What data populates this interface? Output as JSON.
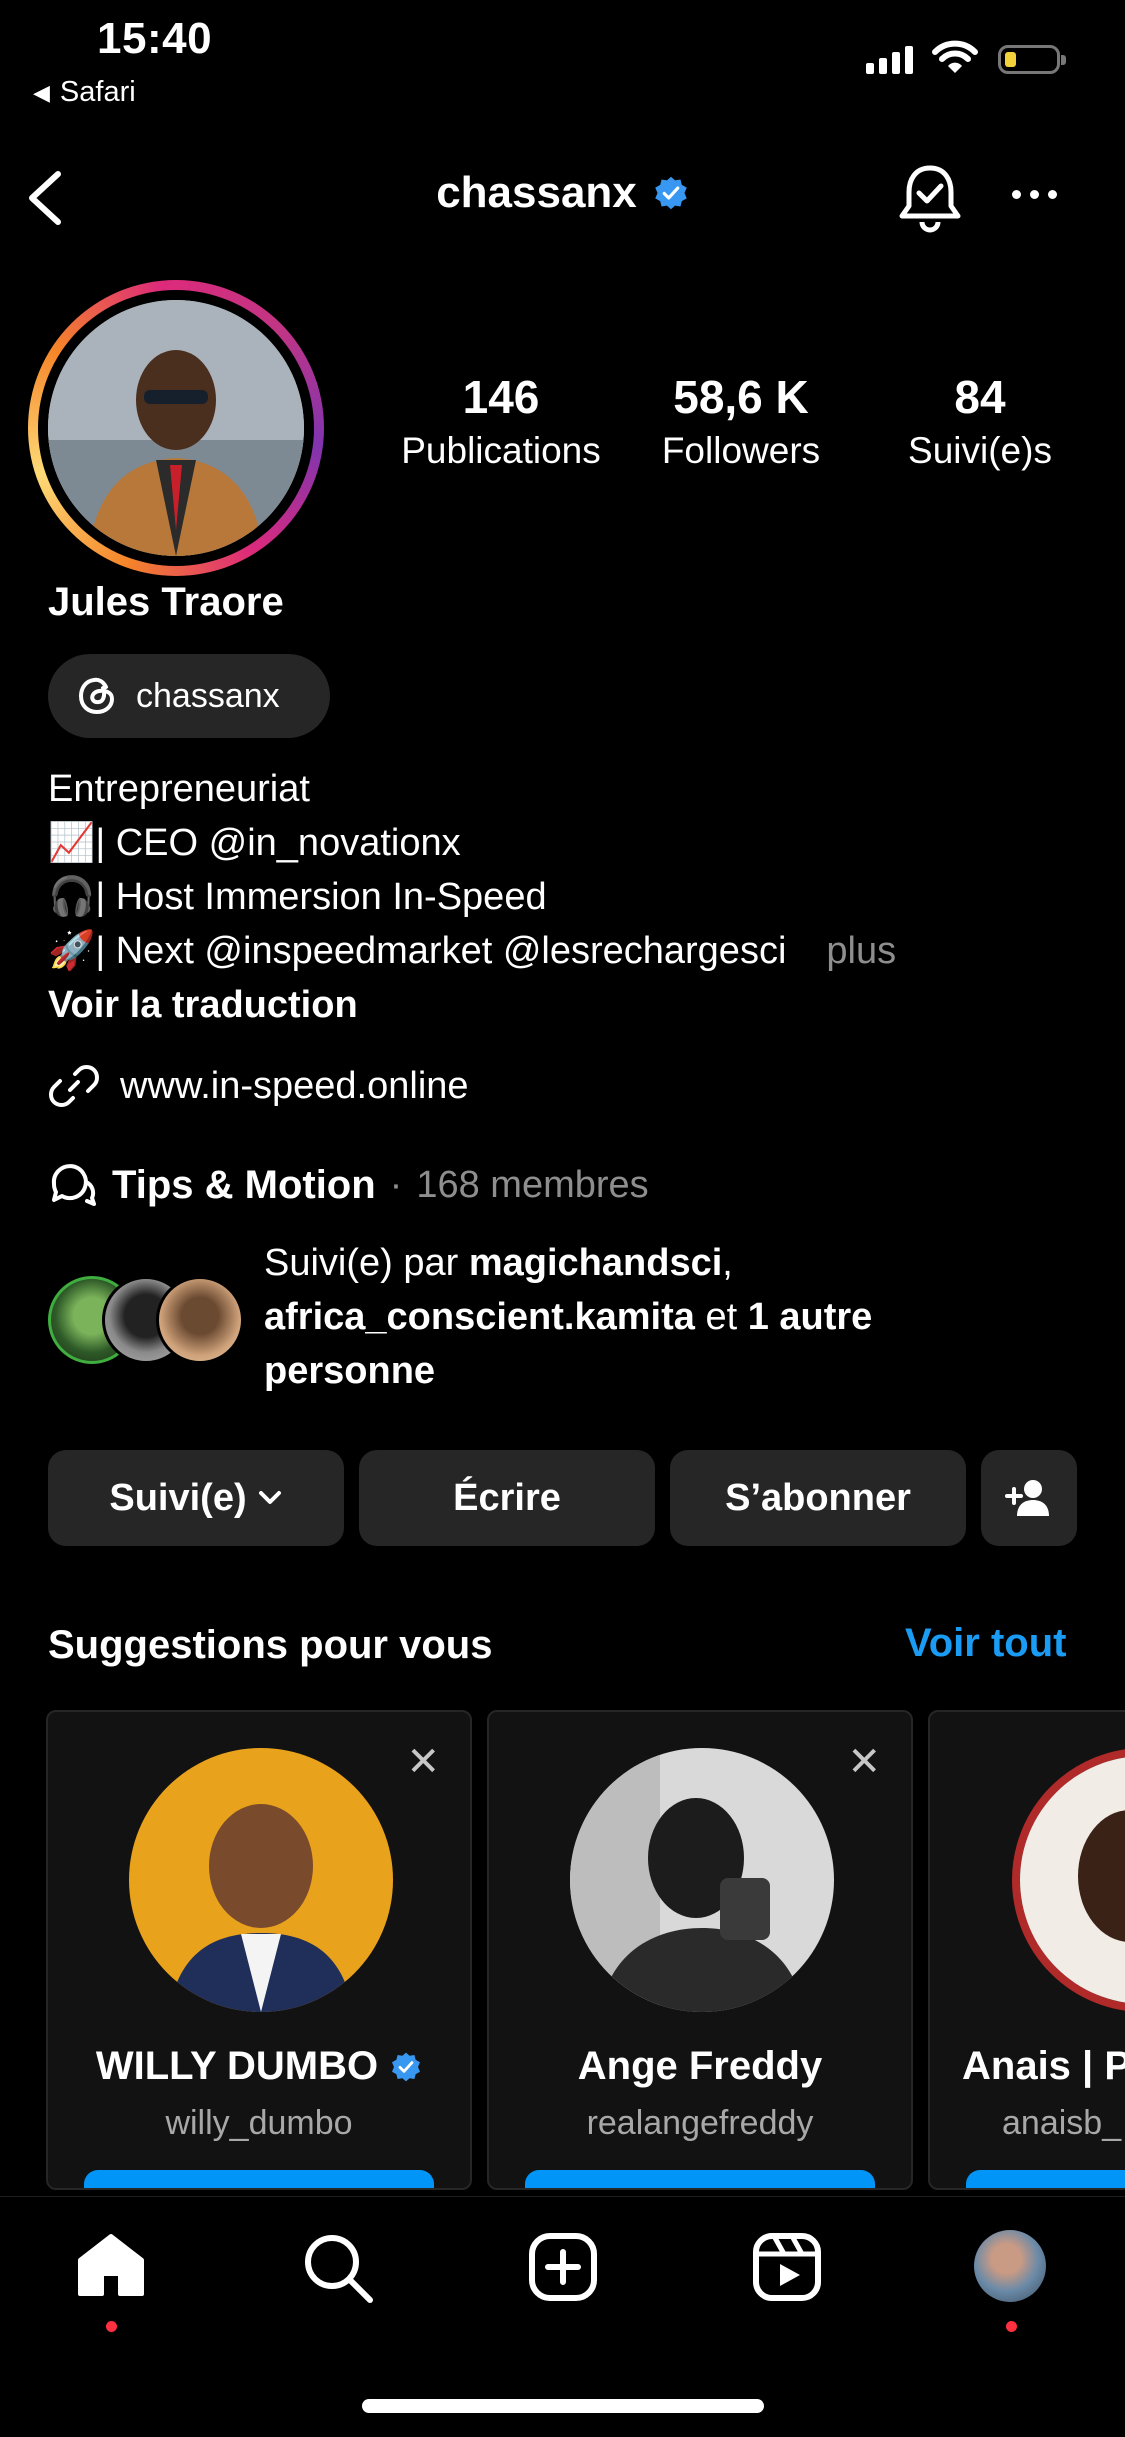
{
  "status_bar": {
    "time": "15:40",
    "back_app": "Safari"
  },
  "header": {
    "username": "chassanx"
  },
  "profile": {
    "full_name": "Jules Traore",
    "threads_handle": "chassanx",
    "stats": [
      {
        "value": "146",
        "label": "Publications"
      },
      {
        "value": "58,6 K",
        "label": "Followers"
      },
      {
        "value": "84",
        "label": "Suivi(e)s"
      }
    ],
    "bio": {
      "line1": "Entrepreneuriat",
      "line2": "📈| CEO @in_novationx",
      "line3": "🎧| Host Immersion In-Speed",
      "line4": "🚀| Next @inspeedmarket @lesrechargesci",
      "more": "plus",
      "translate": "Voir la traduction"
    },
    "link": "www.in-speed.online",
    "channel": {
      "name": "Tips & Motion",
      "separator": "·",
      "members": "168 membres"
    },
    "followed_by": {
      "prefix": "Suivi(e) par ",
      "user1": "magichandsci",
      "comma": ",",
      "user2": "africa_conscient.kamita",
      "middle": " et ",
      "others": "1 autre personne"
    }
  },
  "actions": {
    "following": "Suivi(e)",
    "message": "Écrire",
    "subscribe": "S’abonner"
  },
  "suggestions": {
    "title": "Suggestions pour vous",
    "see_all": "Voir tout",
    "cards": [
      {
        "name": "WILLY DUMBO",
        "username": "willy_dumbo"
      },
      {
        "name": "Ange Freddy",
        "username": "realangefreddy"
      },
      {
        "name": "Anais | P",
        "username": "anaisb_"
      }
    ]
  },
  "colors": {
    "accent": "#1a9cf5",
    "follow_button": "#0095f6",
    "verified": "#3897f0",
    "notification_dot": "#ff3040"
  }
}
